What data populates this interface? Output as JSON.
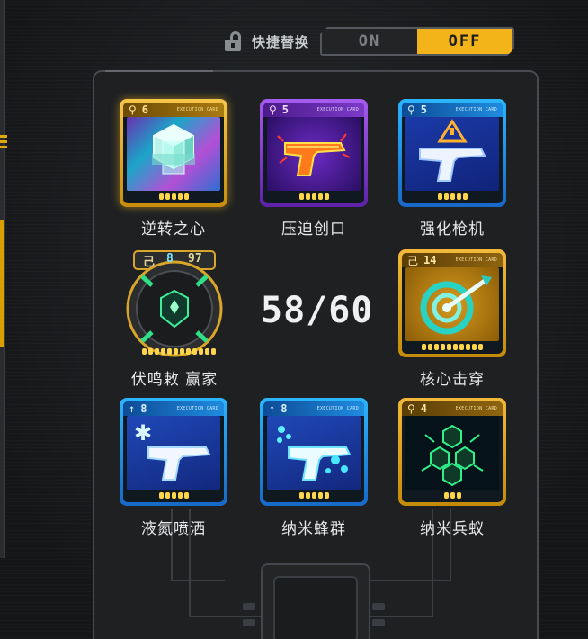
{
  "toggle": {
    "label": "快捷替换",
    "on_label": "ON",
    "off_label": "OFF",
    "selected": "OFF"
  },
  "counter": {
    "text": "58/60"
  },
  "cards": [
    {
      "name": "逆转之心",
      "cost": "6",
      "cost_icon": "key-icon",
      "tag": "EXECUTION CARD",
      "frame": "gold",
      "selected": true,
      "art": "crystal-cube-icon",
      "pips": 5
    },
    {
      "name": "压迫创口",
      "cost": "5",
      "cost_icon": "key-icon",
      "tag": "EXECUTION CARD",
      "frame": "purple",
      "selected": false,
      "art": "flame-pistol-icon",
      "pips": 5
    },
    {
      "name": "强化枪机",
      "cost": "5",
      "cost_icon": "key-icon",
      "tag": "EXECUTION CARD",
      "frame": "blue",
      "selected": false,
      "art": "warning-pistol-icon",
      "pips": 5
    },
    {
      "name": "伏鸣敕 赢家",
      "cost_left": "己",
      "cost": "8",
      "cost_right": "97",
      "frame": "badge",
      "selected": false,
      "art": "emblem-icon",
      "pips": 12
    },
    {
      "name": "核心击穿",
      "cost": "14",
      "cost_icon": "hook-icon",
      "tag": "EXECUTION CARD",
      "frame": "amber",
      "selected": false,
      "art": "target-bullet-icon",
      "pips": 10
    },
    {
      "name": "液氮喷洒",
      "cost": "8",
      "cost_icon": "arrow-up-icon",
      "tag": "EXECUTION CARD",
      "frame": "blue",
      "selected": false,
      "art": "frost-pistol-icon",
      "pips": 5
    },
    {
      "name": "纳米蜂群",
      "cost": "8",
      "cost_icon": "arrow-up-icon",
      "tag": "EXECUTION CARD",
      "frame": "blue",
      "selected": false,
      "art": "swarm-pistol-icon",
      "pips": 5
    },
    {
      "name": "纳米兵蚁",
      "cost": "4",
      "cost_icon": "key-icon",
      "tag": "EXECUTION CARD",
      "frame": "amber",
      "selected": false,
      "art": "hex-ant-icon",
      "pips": 3
    }
  ],
  "colors": {
    "accent": "#f3b41a",
    "gold": "#f6c64a",
    "purple": "#a65cf0",
    "blue": "#2bb6ff",
    "amber": "#f3b93a"
  }
}
